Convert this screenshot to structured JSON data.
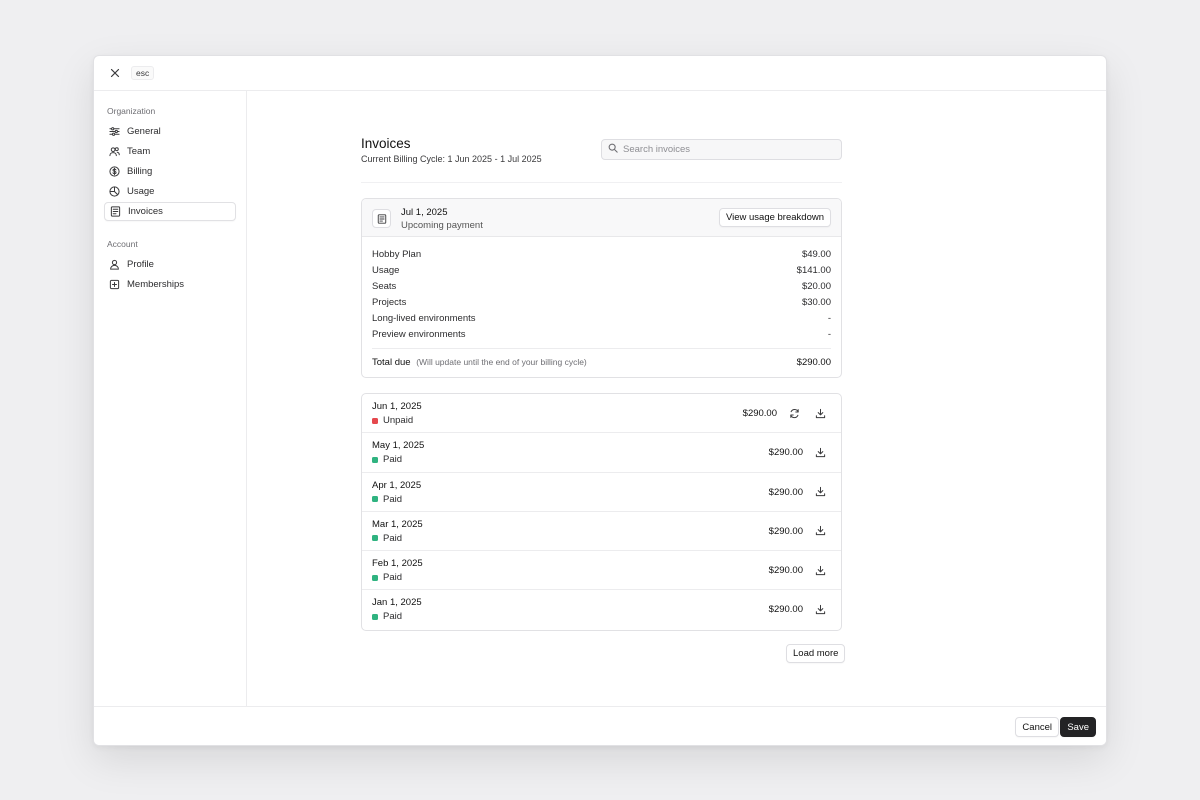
{
  "topbar": {
    "esc_label": "esc"
  },
  "sidebar": {
    "org_heading": "Organization",
    "org_items": [
      {
        "label": "General",
        "icon": "sliders-icon"
      },
      {
        "label": "Team",
        "icon": "users-icon"
      },
      {
        "label": "Billing",
        "icon": "dollar-circle-icon"
      },
      {
        "label": "Usage",
        "icon": "pie-chart-icon"
      },
      {
        "label": "Invoices",
        "icon": "receipt-icon",
        "active": true
      }
    ],
    "account_heading": "Account",
    "account_items": [
      {
        "label": "Profile",
        "icon": "user-icon"
      },
      {
        "label": "Memberships",
        "icon": "plus-square-icon"
      }
    ]
  },
  "main": {
    "title": "Invoices",
    "subtitle": "Current Billing Cycle: 1 Jun 2025 - 1 Jul 2025",
    "search_placeholder": "Search invoices"
  },
  "upcoming": {
    "date": "Jul 1, 2025",
    "status": "Upcoming payment",
    "view_button": "View usage breakdown",
    "items": [
      {
        "label": "Hobby Plan",
        "amount": "$49.00"
      },
      {
        "label": "Usage",
        "amount": "$141.00"
      },
      {
        "label": "Seats",
        "amount": "$20.00"
      },
      {
        "label": "Projects",
        "amount": "$30.00"
      },
      {
        "label": "Long-lived environments",
        "amount": "-"
      },
      {
        "label": "Preview environments",
        "amount": "-"
      }
    ],
    "total_label": "Total due",
    "total_note": "(Will update until the end of your billing cycle)",
    "total_amount": "$290.00"
  },
  "invoices": [
    {
      "date": "Jun 1, 2025",
      "status": "Unpaid",
      "amount": "$290.00"
    },
    {
      "date": "May 1, 2025",
      "status": "Paid",
      "amount": "$290.00"
    },
    {
      "date": "Apr 1, 2025",
      "status": "Paid",
      "amount": "$290.00"
    },
    {
      "date": "Mar 1, 2025",
      "status": "Paid",
      "amount": "$290.00"
    },
    {
      "date": "Feb 1, 2025",
      "status": "Paid",
      "amount": "$290.00"
    },
    {
      "date": "Jan 1, 2025",
      "status": "Paid",
      "amount": "$290.00"
    }
  ],
  "load_more": "Load more",
  "footer": {
    "cancel": "Cancel",
    "save": "Save"
  },
  "colors": {
    "paid": "#2fb380",
    "unpaid": "#e5484d",
    "primary": "#232325"
  }
}
